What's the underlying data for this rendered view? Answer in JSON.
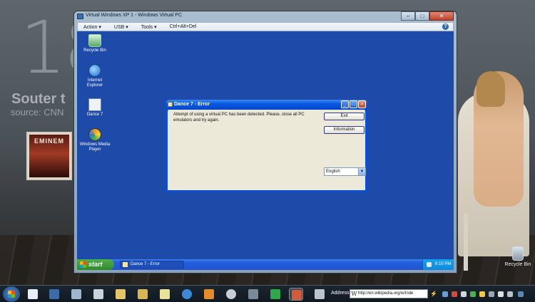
{
  "host_desktop": {
    "clock_partial": "18",
    "news_title_partial": "Souter t",
    "news_source_partial": "source: CNN",
    "album_artist": "EMINEM",
    "recycle_bin_label": "Recycle Bin"
  },
  "vm_window": {
    "title": "Virtual Windows XP 1 - Windows Virtual PC",
    "controls": [
      "–",
      "□",
      "✕"
    ],
    "toolbar": [
      {
        "label": "Action ▾"
      },
      {
        "label": "USB ▾"
      },
      {
        "label": "Tools ▾"
      },
      {
        "label": "Ctrl+Alt+Del"
      }
    ],
    "help_label": "?"
  },
  "xp_desktop": {
    "icons": [
      {
        "name": "recycle-bin",
        "label": "Recycle Bin"
      },
      {
        "name": "internet-explorer",
        "label": "Internet Explorer"
      },
      {
        "name": "dance-7",
        "label": "Dance 7"
      },
      {
        "name": "windows-media-player",
        "label": "Windows Media Player"
      }
    ]
  },
  "dialog": {
    "title": "Dance 7 - Error",
    "message": "Attempt of using a virtual PC has been detected. Please, close all PC emulators and try again.",
    "exit_label": "Exit",
    "info_label": "Information",
    "language_value": "English"
  },
  "xp_taskbar": {
    "start_label": "start",
    "task_label": "Dance 7 - Error",
    "clock": "6:10 PM"
  },
  "host_taskbar": {
    "address_label": "Address",
    "address_value": "http://en.wikipedia.org/w/inde"
  },
  "colors": {
    "xp_desktop": "#1e4aa9",
    "dialog_title": "#0a58e0",
    "start_green": "#2d8b2b"
  }
}
